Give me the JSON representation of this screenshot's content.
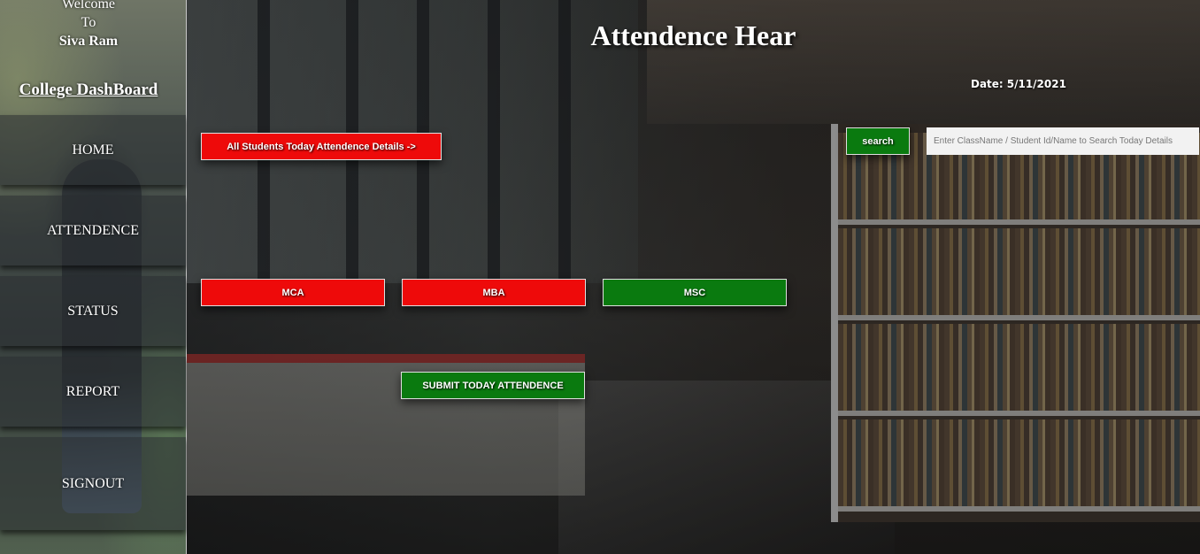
{
  "sidebar": {
    "welcome_line1": "Welcome",
    "welcome_line2": "To",
    "user_name": "Siva Ram",
    "dashboard_title": "College DashBoard",
    "items": [
      {
        "label": "HOME"
      },
      {
        "label": "ATTENDENCE"
      },
      {
        "label": "STATUS"
      },
      {
        "label": "REPORT"
      },
      {
        "label": "SIGNOUT"
      }
    ]
  },
  "main": {
    "heading": "Attendence Hear",
    "date_label": "Date:",
    "date_value": "5/11/2021",
    "all_students_button": "All Students Today Attendence Details ->",
    "search_button": "search",
    "search_placeholder": "Enter ClassName / Student Id/Name to Search Today Details",
    "classes": [
      {
        "label": "MCA",
        "color": "#ee0a0a"
      },
      {
        "label": "MBA",
        "color": "#ee0a0a"
      },
      {
        "label": "MSC",
        "color": "#0a7a0f"
      }
    ],
    "submit_button": "SUBMIT TODAY ATTENDENCE"
  },
  "colors": {
    "red_button": "#ee0a0a",
    "green_button": "#0a7a0f",
    "text": "#ffffff"
  }
}
